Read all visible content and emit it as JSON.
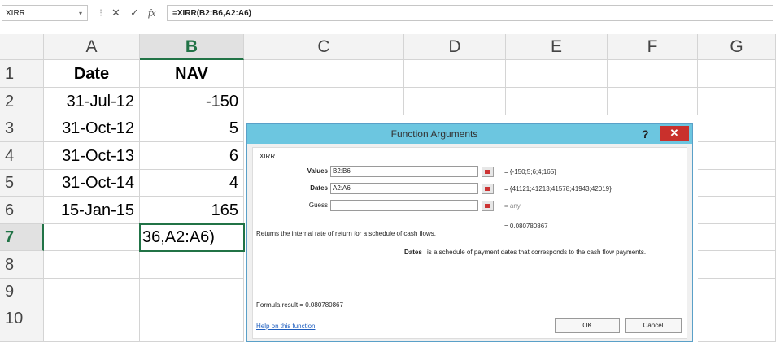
{
  "formula_bar": {
    "name_box": "XIRR",
    "cancel_icon": "✕",
    "enter_icon": "✓",
    "fx_label": "fx",
    "formula": "=XIRR(B2:B6,A2:A6)"
  },
  "grid": {
    "columns": [
      "A",
      "B",
      "C",
      "D",
      "E",
      "F",
      "G"
    ],
    "rows": [
      "1",
      "2",
      "3",
      "4",
      "5",
      "6",
      "7",
      "8",
      "9",
      "10"
    ],
    "active_cell_text": "36,A2:A6)",
    "cells": [
      [
        "Date",
        "NAV"
      ],
      [
        "31-Jul-12",
        "-150"
      ],
      [
        "31-Oct-12",
        "5"
      ],
      [
        "31-Oct-13",
        "6"
      ],
      [
        "31-Oct-14",
        "4"
      ],
      [
        "15-Jan-15",
        "165"
      ]
    ]
  },
  "dialog": {
    "title": "Function Arguments",
    "help": "?",
    "close": "✕",
    "function_name": "XIRR",
    "args": [
      {
        "label": "Values",
        "input": "B2:B6",
        "value": "= {-150;5;6;4;165}"
      },
      {
        "label": "Dates",
        "input": "A2:A6",
        "value": "= {41121;41213;41578;41943;42019}"
      },
      {
        "label": "Guess",
        "input": "",
        "value": "= any"
      }
    ],
    "result_value": "= 0.080780867",
    "description": "Returns the internal rate of return for a schedule of cash flows.",
    "arg_desc_name": "Dates",
    "arg_desc_text": "is a schedule of payment dates that corresponds to the cash flow payments.",
    "formula_result": "Formula result =   0.080780867",
    "help_link": "Help on this function",
    "ok": "OK",
    "cancel": "Cancel"
  },
  "colors": {
    "accent_green": "#217346",
    "dialog_title_bar": "#6cc6e0",
    "close_red": "#c9302c"
  }
}
